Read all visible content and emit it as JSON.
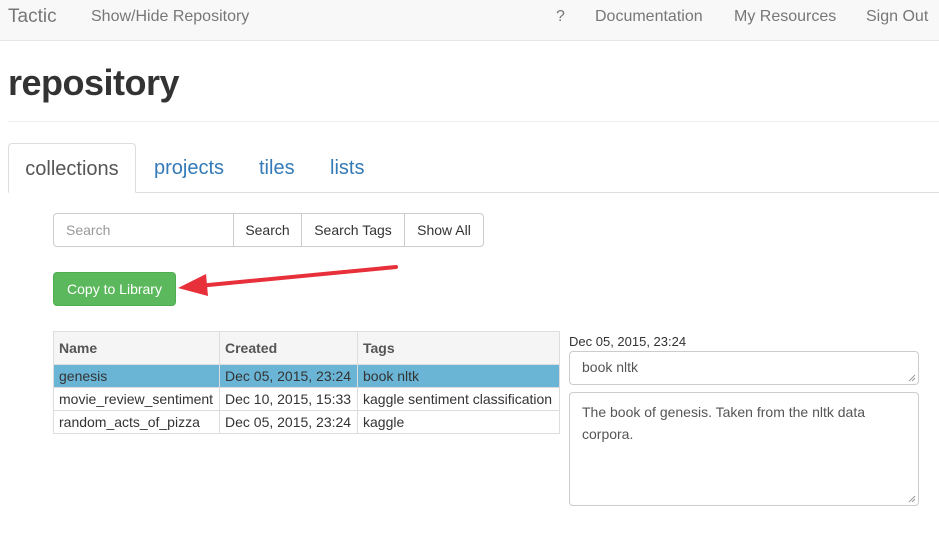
{
  "navbar": {
    "brand": "Tactic",
    "toggle": "Show/Hide Repository",
    "help": "?",
    "documentation": "Documentation",
    "my_resources": "My Resources",
    "sign_out": "Sign Out"
  },
  "page": {
    "title": "repository"
  },
  "tabs": [
    {
      "label": "collections",
      "active": true
    },
    {
      "label": "projects"
    },
    {
      "label": "tiles"
    },
    {
      "label": "lists"
    }
  ],
  "search": {
    "placeholder": "Search",
    "search_label": "Search",
    "search_tags_label": "Search Tags",
    "show_all_label": "Show All"
  },
  "copy_button": "Copy to Library",
  "table": {
    "columns": [
      "Name",
      "Created",
      "Tags"
    ],
    "rows": [
      {
        "name": "genesis",
        "created": "Dec 05, 2015, 23:24",
        "tags": "book nltk",
        "selected": true
      },
      {
        "name": "movie_review_sentiment",
        "created": "Dec 10, 2015, 15:33",
        "tags": "kaggle sentiment classification"
      },
      {
        "name": "random_acts_of_pizza",
        "created": "Dec 05, 2015, 23:24",
        "tags": "kaggle"
      }
    ]
  },
  "detail": {
    "date": "Dec 05, 2015, 23:24",
    "tags": "book nltk",
    "description": "The book of genesis. Taken from the nltk data corpora."
  },
  "colors": {
    "accent": "#337ab7",
    "success": "#5cb85c",
    "selected_row": "#6ab5d6",
    "arrow": "#e8303a"
  }
}
